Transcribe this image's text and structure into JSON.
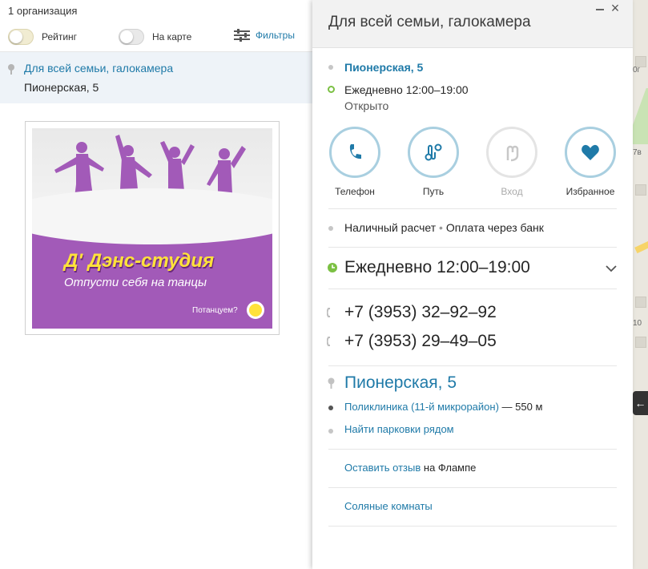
{
  "list": {
    "count_label": "1 организация",
    "toggles": [
      {
        "label": "Рейтинг",
        "on": true
      },
      {
        "label": "На карте",
        "on": false
      }
    ],
    "filters_label": "Фильтры",
    "result": {
      "name": "Для всей семьи, галокамера",
      "address": "Пионерская, 5"
    },
    "ad": {
      "title": "Д' Дэнс-студия",
      "subtitle": "Отпусти себя на танцы",
      "cta": "Потанцуем?"
    }
  },
  "map": {
    "labels": [
      "0г",
      "7в",
      "10"
    ]
  },
  "card": {
    "title": "Для всей семьи, галокамера",
    "address": "Пионерская, 5",
    "hours_short": "Ежедневно 12:00–19:00",
    "status": "Открыто",
    "actions": [
      {
        "label": "Телефон",
        "icon": "phone-icon",
        "enabled": true
      },
      {
        "label": "Путь",
        "icon": "route-icon",
        "enabled": true
      },
      {
        "label": "Вход",
        "icon": "entrance-icon",
        "enabled": false
      },
      {
        "label": "Избранное",
        "icon": "heart-icon",
        "enabled": true
      }
    ],
    "payment": {
      "cash": "Наличный расчет",
      "separator": "•",
      "bank": "Оплата через банк"
    },
    "hours_full": "Ежедневно 12:00–19:00",
    "phones": [
      "+7 (3953) 32–92–92",
      "+7 (3953) 29–49–05"
    ],
    "address_big": "Пионерская, 5",
    "nearby": {
      "place": "Поликлиника (11-й микрорайон)",
      "distance": "— 550 м"
    },
    "parking_link": "Найти парковки рядом",
    "review": {
      "link": "Оставить отзыв",
      "suffix": "на Флампе"
    },
    "category_link": "Соляные комнаты",
    "colors": {
      "accent": "#1f7aa8",
      "open_status": "#7bc043",
      "ring": "#a9cfe0"
    }
  }
}
